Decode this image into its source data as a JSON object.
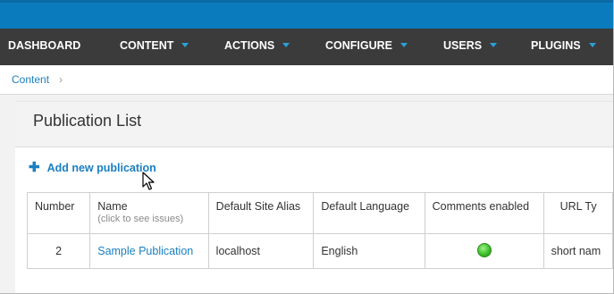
{
  "nav": {
    "items": [
      {
        "label": "DASHBOARD",
        "has_dropdown": false
      },
      {
        "label": "CONTENT",
        "has_dropdown": true
      },
      {
        "label": "ACTIONS",
        "has_dropdown": true
      },
      {
        "label": "CONFIGURE",
        "has_dropdown": true
      },
      {
        "label": "USERS",
        "has_dropdown": true
      },
      {
        "label": "PLUGINS",
        "has_dropdown": true
      }
    ]
  },
  "breadcrumb": {
    "item": "Content",
    "separator": "›"
  },
  "page": {
    "title": "Publication List",
    "add_link": "Add new publication"
  },
  "table": {
    "headers": [
      {
        "label": "Number",
        "sub": ""
      },
      {
        "label": "Name",
        "sub": "(click to see issues)"
      },
      {
        "label": "Default Site Alias",
        "sub": ""
      },
      {
        "label": "Default Language",
        "sub": ""
      },
      {
        "label": "Comments enabled",
        "sub": ""
      },
      {
        "label": "URL Ty",
        "sub": ""
      }
    ],
    "rows": [
      {
        "number": "2",
        "name": "Sample Publication",
        "alias": "localhost",
        "language": "English",
        "comments_enabled": true,
        "url_type": "short nam"
      }
    ]
  },
  "colors": {
    "accent": "#0a7bbd",
    "nav_bg": "#3b3b3b",
    "link": "#1a7fc1",
    "status_on": "#3cbf2a"
  }
}
